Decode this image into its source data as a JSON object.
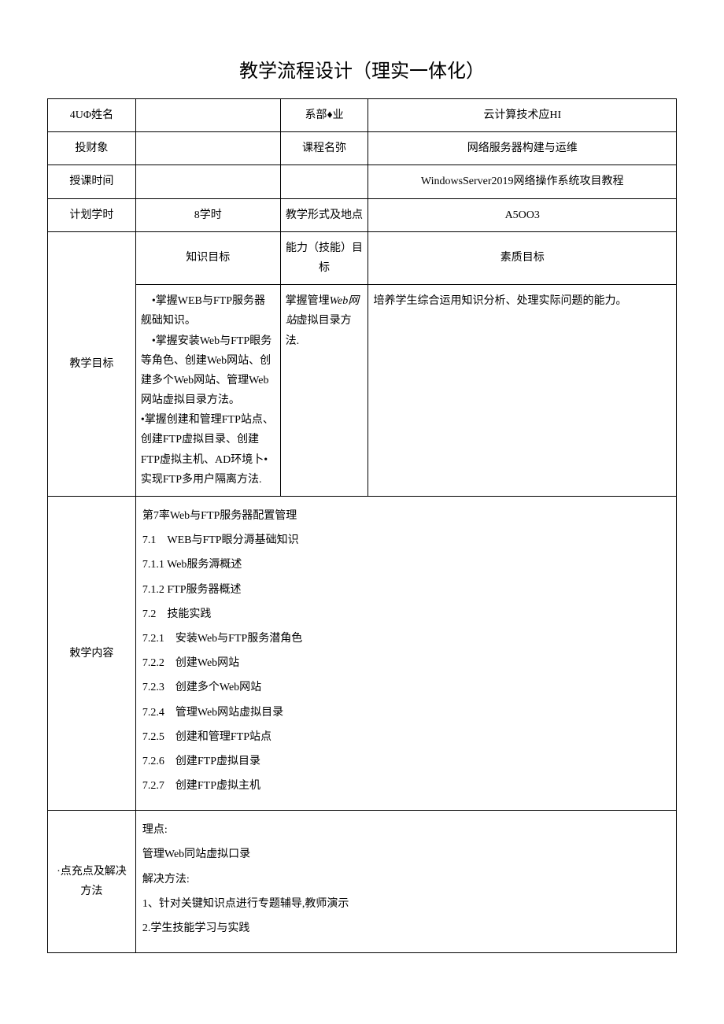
{
  "title": "教学流程设计（理实一体化）",
  "row1": {
    "label": "4UΦ姓名",
    "v1": "",
    "label2": "系部♦业",
    "v2": "云计算技术应HI"
  },
  "row2": {
    "label": "投财象",
    "v1": "",
    "label2": "课程名弥",
    "v2": "网络服务器构建与运维"
  },
  "row3": {
    "label": "授课时间",
    "v1": "",
    "label2": "",
    "v2": "WindowsServer2019网络操作系统攻目教程"
  },
  "row4": {
    "label": "计划学时",
    "v1": "8学时",
    "label2": "教学形式及地点",
    "v2": "A5OO3"
  },
  "goals": {
    "label": "教学目标",
    "h1": "知识目标",
    "h2": "能力（技能）目标",
    "h3": "素质目标",
    "c1": "　•掌握WEB与FTP服务器舰础知识。\n　•掌握安装Web与FTP眼务等角色、创建Web网站、创建多个Web网站、管理Web网站虚拟目录方法。\n•掌握创建和管理FTP站点、创建FTP虚拟目录、创建FTP虚拟主机、AD环境卜•实现FTP多用户隔离方法.",
    "c2_a": "掌握管埋",
    "c2_b": "Web网站",
    "c2_c": "虚拟目录方法.",
    "c3": "培养学生综合运用知识分析、处理实际问题的能力。"
  },
  "content": {
    "label": "敕学内容",
    "lines": [
      "第7率Web与FTP服务器配置管理",
      "7.1　WEB与FTP眼分溽基础知识",
      "7.1.1  Web服务溽概述",
      "7.1.2  FTP服务器概述",
      "7.2　技能实践",
      "7.2.1　安装Web与FTP服务潜角色",
      "7.2.2　创建Web网站",
      "7.2.3　创建多个Web网站",
      "7.2.4　管理Web网站虚拟目录",
      "7.2.5　创建和管理FTP站点",
      "7.2.6　创建FTP虚拟目录",
      "7.2.7　创建FTP虚拟主机"
    ]
  },
  "difficulty": {
    "label": "·点充点及解决方法",
    "lines": [
      "理点:",
      "管理Web同站虚拟口录",
      "解决方法:",
      "1、针对关键知识点进行专题辅导,教师演示",
      "2.学生技能学习与实践"
    ]
  }
}
